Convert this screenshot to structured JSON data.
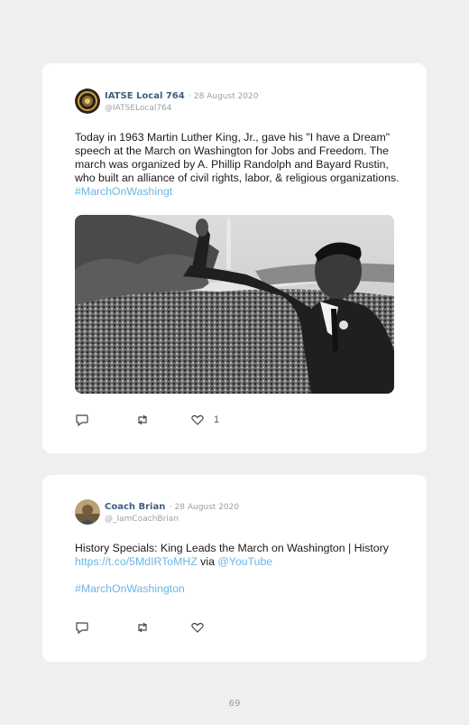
{
  "tweets": [
    {
      "name": "IATSE Local 764",
      "date": "· 28 August 2020",
      "handle": "@IATSELocal764",
      "text": "Today in 1963 Martin Luther King, Jr., gave his \"I have a Dream\" speech at the March on Washington for Jobs and Freedom. The march was organized by A. Phillip Randolph and Bayard Rustin, who built an alliance of civil rights, labor, & religious organizations. ",
      "hashtag": "#MarchOnWashingt",
      "likes": "1"
    },
    {
      "name": "Coach Brian",
      "date": "· 28 August 2020",
      "handle": "@_IamCoachBrian",
      "text": "History Specials: King Leads the March on Washington | History ",
      "link": "https://t.co/5MdIRToMHZ",
      "via": " via ",
      "mention": "@YouTube",
      "hashtag": "#MarchOnWashington"
    }
  ],
  "page_number": "69",
  "colors": {
    "link": "#6ab6e6",
    "name": "#3f5f7f",
    "muted": "#9aa0a6"
  },
  "icons": [
    "reply-icon",
    "retweet-icon",
    "heart-icon"
  ]
}
